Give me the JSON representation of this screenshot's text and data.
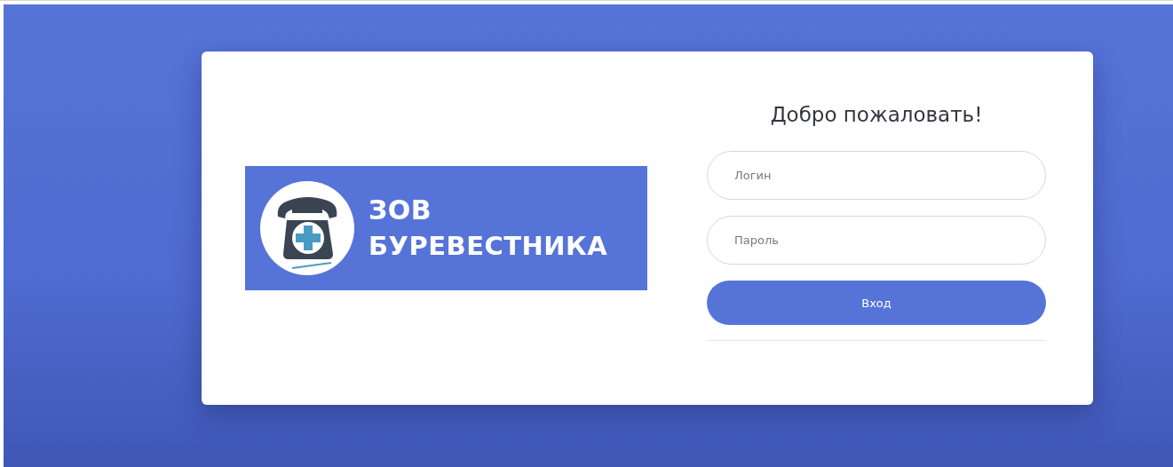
{
  "logo": {
    "line_1": "ЗОВ",
    "line_2": "БУРЕВЕСТНИКА"
  },
  "login_form": {
    "title": "Добро пожаловать!",
    "fields": [
      {
        "placeholder": "Логин"
      },
      {
        "placeholder": "Пароль"
      }
    ],
    "submit": "Вход"
  }
}
